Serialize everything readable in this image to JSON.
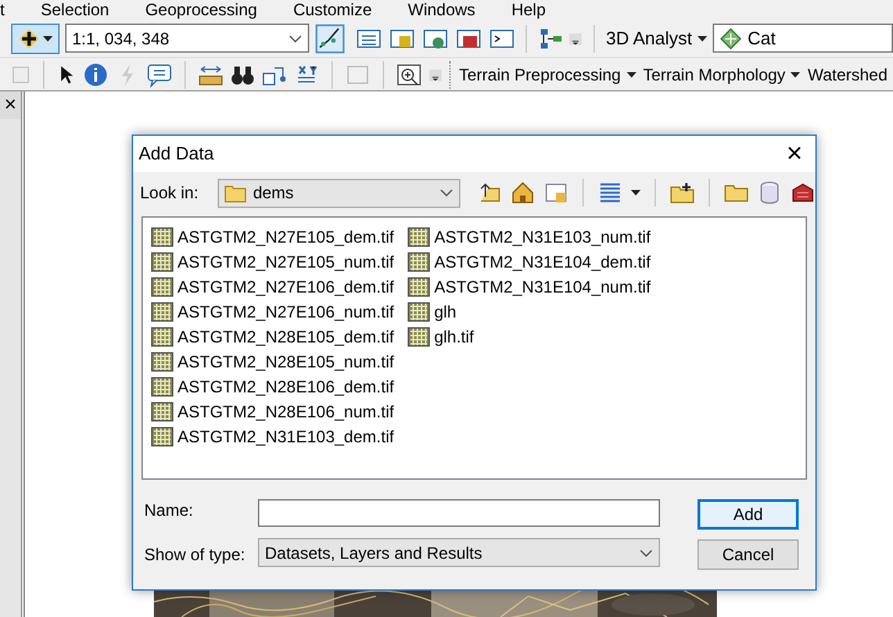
{
  "menu_bar": [
    "t",
    "Selection",
    "Geoprocessing",
    "Customize",
    "Windows",
    "Help"
  ],
  "toolbar_top": {
    "scale": "1:1, 034, 348",
    "analyst_menu": "3D Analyst",
    "layer": "Cat"
  },
  "toolbar_bottom": {
    "menus": [
      "Terrain Preprocessing",
      "Terrain Morphology",
      "Watershed"
    ]
  },
  "side_panel": {
    "close": "×"
  },
  "dialog": {
    "title": "Add Data",
    "close": "×",
    "look_in_label": "Look in:",
    "look_in": "dems",
    "files": [
      "ASTGTM2_N27E105_dem.tif",
      "ASTGTM2_N27E105_num.tif",
      "ASTGTM2_N27E106_dem.tif",
      "ASTGTM2_N27E106_num.tif",
      "ASTGTM2_N28E105_dem.tif",
      "ASTGTM2_N28E105_num.tif",
      "ASTGTM2_N28E106_dem.tif",
      "ASTGTM2_N28E106_num.tif",
      "ASTGTM2_N31E103_dem.tif",
      "ASTGTM2_N31E103_num.tif",
      "ASTGTM2_N31E104_dem.tif",
      "ASTGTM2_N31E104_num.tif",
      "glh",
      "glh.tif"
    ],
    "name_label": "Name:",
    "type_label": "Show of type:",
    "type_value": "Datasets, Layers and Results",
    "buttons": [
      {
        "label": "Add",
        "kind": "default"
      },
      {
        "label": "Cancel",
        "kind": "normal"
      }
    ]
  }
}
